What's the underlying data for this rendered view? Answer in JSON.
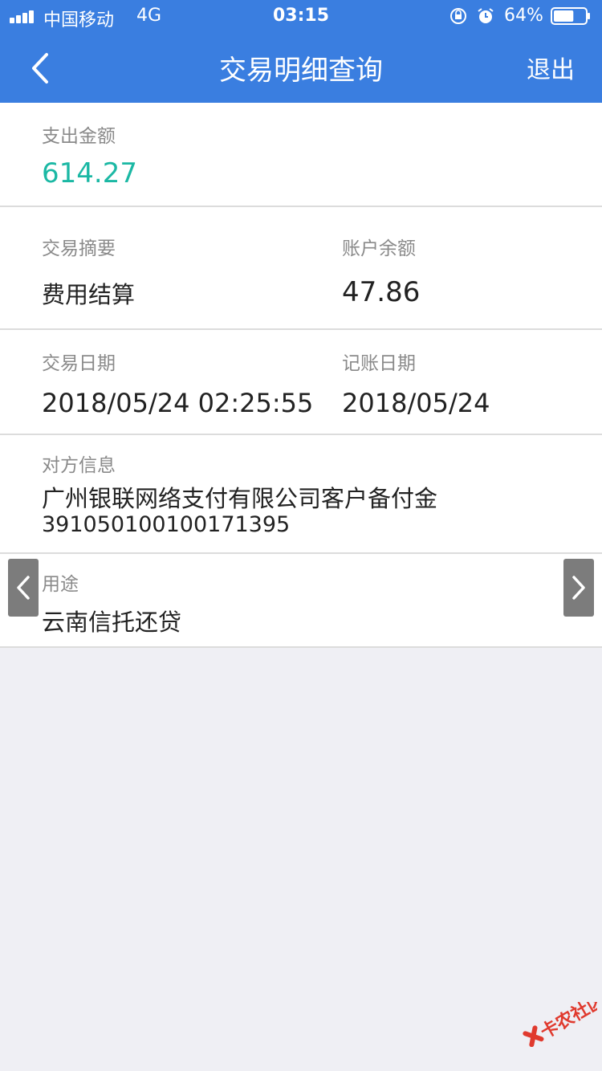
{
  "status_bar": {
    "carrier": "中国移动",
    "network": "4G",
    "time": "03:15",
    "battery_percent": "64%",
    "battery_level": 0.64,
    "icons": [
      "signal-icon",
      "orientation-lock-icon",
      "alarm-icon",
      "battery-icon"
    ]
  },
  "nav": {
    "back_icon": "chevron-left-icon",
    "title": "交易明细查询",
    "exit_label": "退出"
  },
  "detail": {
    "amount_label": "支出金额",
    "amount_value": "614.27",
    "summary_label": "交易摘要",
    "summary_value": "费用结算",
    "balance_label": "账户余额",
    "balance_value": "47.86",
    "trade_date_label": "交易日期",
    "trade_date_value": "2018/05/24 02:25:55",
    "post_date_label": "记账日期",
    "post_date_value": "2018/05/24",
    "counterparty_label": "对方信息",
    "counterparty_name": "广州银联网络支付有限公司客户备付金",
    "counterparty_account": "391050100100171395",
    "purpose_label": "用途",
    "purpose_value": "云南信托还贷"
  },
  "watermark": {
    "text": "卡农社区"
  },
  "colors": {
    "header": "#3a7ee0",
    "amount": "#1bb8a4",
    "background": "#efeff4",
    "side_arrow": "#7c7c7c",
    "watermark": "#e03a2e"
  }
}
